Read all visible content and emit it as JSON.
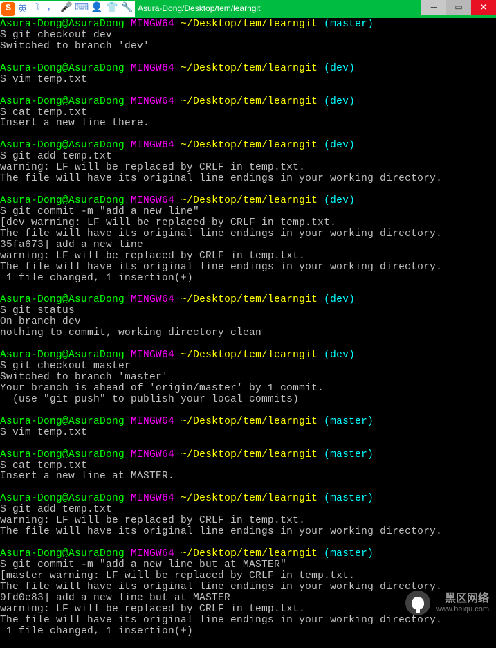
{
  "window": {
    "title": "Asura-Dong/Desktop/tem/learngit"
  },
  "ime": {
    "logo": "S",
    "lang": "英"
  },
  "prompt": {
    "user": "Asura-Dong@AsuraDong",
    "shell": "MINGW64",
    "path": "~/Desktop/tem/learngit"
  },
  "branches": {
    "master": "(master)",
    "dev": "(dev)"
  },
  "blocks": [
    {
      "branch": "master",
      "cmd": "$ git checkout dev",
      "out": [
        "Switched to branch 'dev'"
      ]
    },
    {
      "branch": "dev",
      "cmd": "$ vim temp.txt",
      "out": []
    },
    {
      "branch": "dev",
      "cmd": "$ cat temp.txt",
      "out": [
        "Insert a new line there."
      ]
    },
    {
      "branch": "dev",
      "cmd": "$ git add temp.txt",
      "out": [
        "warning: LF will be replaced by CRLF in temp.txt.",
        "The file will have its original line endings in your working directory."
      ]
    },
    {
      "branch": "dev",
      "cmd": "$ git commit -m \"add a new line\"",
      "out": [
        "[dev warning: LF will be replaced by CRLF in temp.txt.",
        "The file will have its original line endings in your working directory.",
        "35fa673] add a new line",
        "warning: LF will be replaced by CRLF in temp.txt.",
        "The file will have its original line endings in your working directory.",
        " 1 file changed, 1 insertion(+)"
      ]
    },
    {
      "branch": "dev",
      "cmd": "$ git status",
      "out": [
        "On branch dev",
        "nothing to commit, working directory clean"
      ]
    },
    {
      "branch": "dev",
      "cmd": "$ git checkout master",
      "out": [
        "Switched to branch 'master'",
        "Your branch is ahead of 'origin/master' by 1 commit.",
        "  (use \"git push\" to publish your local commits)"
      ]
    },
    {
      "branch": "master",
      "cmd": "$ vim temp.txt",
      "out": []
    },
    {
      "branch": "master",
      "cmd": "$ cat temp.txt",
      "out": [
        "Insert a new line at MASTER."
      ]
    },
    {
      "branch": "master",
      "cmd": "$ git add temp.txt",
      "out": [
        "warning: LF will be replaced by CRLF in temp.txt.",
        "The file will have its original line endings in your working directory."
      ]
    },
    {
      "branch": "master",
      "cmd": "$ git commit -m \"add a new line but at MASTER\"",
      "out": [
        "[master warning: LF will be replaced by CRLF in temp.txt.",
        "The file will have its original line endings in your working directory.",
        "9fd0e83] add a new line but at MASTER",
        "warning: LF will be replaced by CRLF in temp.txt.",
        "The file will have its original line endings in your working directory.",
        " 1 file changed, 1 insertion(+)"
      ]
    }
  ],
  "watermark": {
    "main": "黑区网络",
    "url": "www.heiqu.com"
  }
}
